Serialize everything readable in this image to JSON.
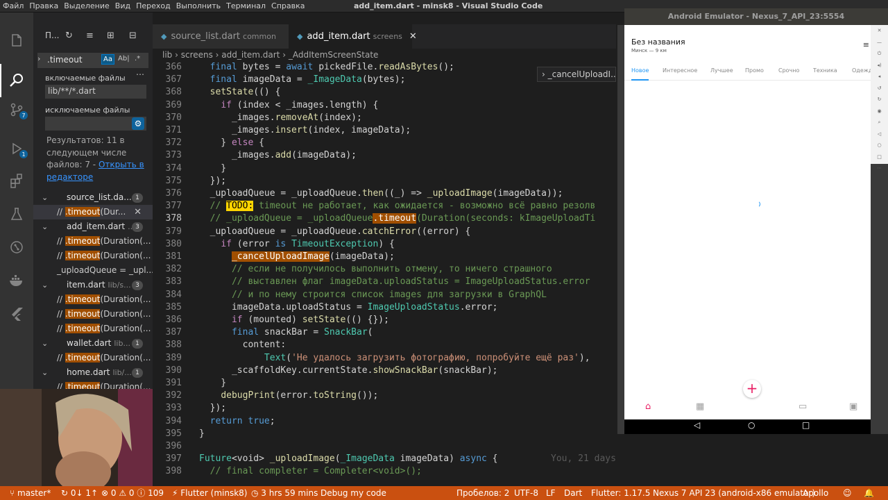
{
  "window": {
    "menu": [
      "Файл",
      "Правка",
      "Выделение",
      "Вид",
      "Переход",
      "Выполнить",
      "Терминал",
      "Справка"
    ],
    "title": "add_item.dart - minsk8 - Visual Studio Code"
  },
  "sidebar": {
    "header_label": "П...",
    "search_value": ".timeout",
    "opt_case": "Aa",
    "opt_word": "Ab|",
    "opt_regex": ".*",
    "include_label": "включаемые файлы",
    "include_value": "lib/**/*.dart",
    "exclude_label": "исключаемые файлы",
    "results_text": "Результатов: 11 в следующем числе файлов: 7 - ",
    "results_link": "Открыть в редакторе",
    "files": [
      {
        "name": "source_list.da...",
        "path": "",
        "count": "1",
        "matches": [
          {
            "pre": "// ",
            "hit": ".timeout",
            "post": "(Dur..."
          }
        ]
      },
      {
        "name": "add_item.dart",
        "path": "...",
        "count": "3",
        "matches": [
          {
            "pre": "// ",
            "hit": ".timeout",
            "post": "(Duration(..."
          },
          {
            "pre": "// ",
            "hit": ".timeout",
            "post": "(Duration(..."
          },
          {
            "pre": "_uploadQueue = _upl...",
            "hit": "",
            "post": ""
          }
        ]
      },
      {
        "name": "item.dart",
        "path": "lib/s...",
        "count": "3",
        "matches": [
          {
            "pre": "// ",
            "hit": ".timeout",
            "post": "(Duration(..."
          },
          {
            "pre": "// ",
            "hit": ".timeout",
            "post": "(Duration(..."
          },
          {
            "pre": "// ",
            "hit": ".timeout",
            "post": "(Duration(..."
          }
        ]
      },
      {
        "name": "wallet.dart",
        "path": "lib...",
        "count": "1",
        "matches": [
          {
            "pre": "// ",
            "hit": ".timeout",
            "post": "(Duration(..."
          }
        ]
      },
      {
        "name": "home.dart",
        "path": "lib/...",
        "count": "1",
        "matches": [
          {
            "pre": "// ",
            "hit": ".timeout",
            "post": "(Duration(..."
          }
        ]
      }
    ]
  },
  "editor": {
    "tabs": [
      {
        "name": "source_list.dart",
        "sub": "common"
      },
      {
        "name": "add_item.dart",
        "sub": "screens"
      }
    ],
    "breadcrumb": "lib  ›  screens  ›  add_item.dart  ›  _AddItemScreenState",
    "outline_popup": "_cancelUploadI...",
    "blame": "You, 21 days",
    "lines": [
      {
        "n": "366",
        "t": "  final bytes = await pickedFile.readAsBytes();"
      },
      {
        "n": "367",
        "t": "  final imageData = _ImageData(bytes);"
      },
      {
        "n": "368",
        "t": "  setState(() {"
      },
      {
        "n": "369",
        "t": "    if (index < _images.length) {"
      },
      {
        "n": "370",
        "t": "      _images.removeAt(index);"
      },
      {
        "n": "371",
        "t": "      _images.insert(index, imageData);"
      },
      {
        "n": "372",
        "t": "    } else {"
      },
      {
        "n": "373",
        "t": "      _images.add(imageData);"
      },
      {
        "n": "374",
        "t": "    }"
      },
      {
        "n": "375",
        "t": "  });"
      },
      {
        "n": "376",
        "t": "  _uploadQueue = _uploadQueue.then((_) => _uploadImage(imageData));"
      },
      {
        "n": "377",
        "t": "  // TODO: timeout не работает, как ожидается - возможно всё равно резолв"
      },
      {
        "n": "378",
        "t": "  // _uploadQueue = _uploadQueue.timeout(Duration(seconds: kImageUploadTi"
      },
      {
        "n": "379",
        "t": "  _uploadQueue = _uploadQueue.catchError((error) {"
      },
      {
        "n": "380",
        "t": "    if (error is TimeoutException) {"
      },
      {
        "n": "381",
        "t": "      _cancelUploadImage(imageData);"
      },
      {
        "n": "382",
        "t": "      // если не получилось выполнить отмену, то ничего страшного"
      },
      {
        "n": "383",
        "t": "      // выставлен флаг imageData.uploadStatus = ImageUploadStatus.error"
      },
      {
        "n": "384",
        "t": "      // и по нему строится список images для загрузки в GraphQL"
      },
      {
        "n": "385",
        "t": "      imageData.uploadStatus = ImageUploadStatus.error;"
      },
      {
        "n": "386",
        "t": "      if (mounted) setState(() {});"
      },
      {
        "n": "387",
        "t": "      final snackBar = SnackBar("
      },
      {
        "n": "388",
        "t": "        content:"
      },
      {
        "n": "389",
        "t": "            Text('Не удалось загрузить фотографию, попробуйте ещё раз'),"
      },
      {
        "n": "390",
        "t": "      _scaffoldKey.currentState.showSnackBar(snackBar);"
      },
      {
        "n": "391",
        "t": "    }"
      },
      {
        "n": "392",
        "t": "    debugPrint(error.toString());"
      },
      {
        "n": "393",
        "t": "  });"
      },
      {
        "n": "394",
        "t": "  return true;"
      },
      {
        "n": "395",
        "t": "}"
      },
      {
        "n": "396",
        "t": ""
      },
      {
        "n": "397",
        "t": "Future<void> _uploadImage(_ImageData imageData) async {"
      },
      {
        "n": "398",
        "t": "  // final completer = Completer<void>();"
      }
    ]
  },
  "emulator": {
    "title": "Android Emulator - Nexus_7_API_23:5554",
    "app_title": "Без названия",
    "app_sub": "Минск — 9 км",
    "tabs": [
      "Новое",
      "Интересное",
      "Лучшее",
      "Промо",
      "Срочно",
      "Техника",
      "Одежд"
    ]
  },
  "status": {
    "branch": "master*",
    "sync": "0↓ 1↑",
    "problems": "⊗ 0 ⚠ 0 ⓘ 109",
    "flutter": "Flutter (minsk8)",
    "time": "3 hrs 59 mins",
    "debug": "Debug my code",
    "spaces": "Пробелов: 2",
    "encoding": "UTF-8",
    "eol": "LF",
    "lang": "Dart",
    "flutter_ver": "Flutter: 1.17.5",
    "device": "Nexus 7 API 23 (android-x86 emulator)",
    "apollo": "Apollo"
  },
  "colors": {
    "statusbar": "#ca5010",
    "accent": "#2196f3",
    "fab": "#e91e63"
  }
}
